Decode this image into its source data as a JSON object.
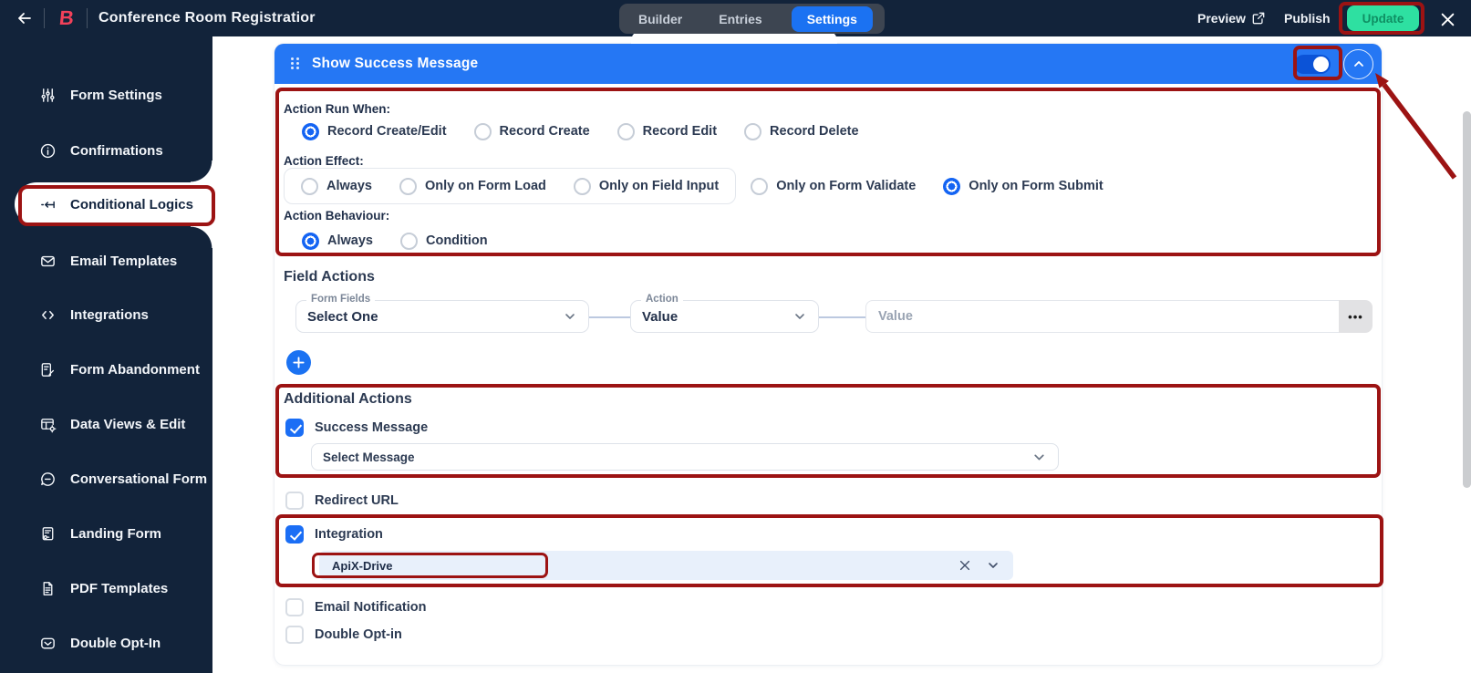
{
  "topbar": {
    "logo_letter": "B",
    "title": "Conference Room Registratior",
    "tabs": [
      {
        "label": "Builder",
        "active": false
      },
      {
        "label": "Entries",
        "active": false
      },
      {
        "label": "Settings",
        "active": true
      }
    ],
    "preview_label": "Preview",
    "publish_label": "Publish",
    "update_label": "Update"
  },
  "sidebar": {
    "items": [
      {
        "label": "Form Settings",
        "active": false
      },
      {
        "label": "Confirmations",
        "active": false
      },
      {
        "label": "Conditional Logics",
        "active": true
      },
      {
        "label": "Email Templates",
        "active": false
      },
      {
        "label": "Integrations",
        "active": false
      },
      {
        "label": "Form Abandonment",
        "active": false
      },
      {
        "label": "Data Views & Edit",
        "active": false
      },
      {
        "label": "Conversational Form",
        "active": false
      },
      {
        "label": "Landing Form",
        "active": false
      },
      {
        "label": "PDF Templates",
        "active": false
      },
      {
        "label": "Double Opt-In",
        "active": false
      }
    ]
  },
  "panel": {
    "header": {
      "title": "Show Success Message",
      "toggle_on": true
    },
    "action_run_when": {
      "label": "Action Run When:",
      "options": [
        {
          "label": "Record Create/Edit",
          "selected": true
        },
        {
          "label": "Record Create",
          "selected": false
        },
        {
          "label": "Record Edit",
          "selected": false
        },
        {
          "label": "Record Delete",
          "selected": false
        }
      ]
    },
    "action_effect": {
      "label": "Action Effect:",
      "options": [
        {
          "label": "Always",
          "selected": false,
          "grouped": true
        },
        {
          "label": "Only on Form Load",
          "selected": false,
          "grouped": true
        },
        {
          "label": "Only on Field Input",
          "selected": false,
          "grouped": true
        },
        {
          "label": "Only on Form Validate",
          "selected": false,
          "grouped": false
        },
        {
          "label": "Only on Form Submit",
          "selected": true,
          "grouped": false
        }
      ]
    },
    "action_behaviour": {
      "label": "Action Behaviour:",
      "options": [
        {
          "label": "Always",
          "selected": true
        },
        {
          "label": "Condition",
          "selected": false
        }
      ]
    },
    "field_actions": {
      "heading": "Field Actions",
      "form_fields_select": {
        "label": "Form Fields",
        "value": "Select One"
      },
      "action_select": {
        "label": "Action",
        "value": "Value"
      },
      "value_input": {
        "placeholder": "Value"
      },
      "ellipsis": "•••",
      "plus": "+"
    },
    "additional_actions": {
      "heading": "Additional Actions",
      "success_message": {
        "label": "Success Message",
        "checked": true
      },
      "success_select_value": "Select Message",
      "redirect_url": {
        "label": "Redirect URL",
        "checked": false
      },
      "integration": {
        "label": "Integration",
        "checked": true
      },
      "integration_value": "ApiX-Drive",
      "email_notification": {
        "label": "Email Notification",
        "checked": false
      },
      "double_opt_in": {
        "label": "Double Opt-in",
        "checked": false
      }
    }
  },
  "colors": {
    "navy": "#12233a",
    "accent_blue": "#1b72f2",
    "header_blue": "#2577f4",
    "update_green": "#2ee0a1",
    "annotation_red": "#9c1313",
    "integration_bg": "#e8f0fb"
  }
}
